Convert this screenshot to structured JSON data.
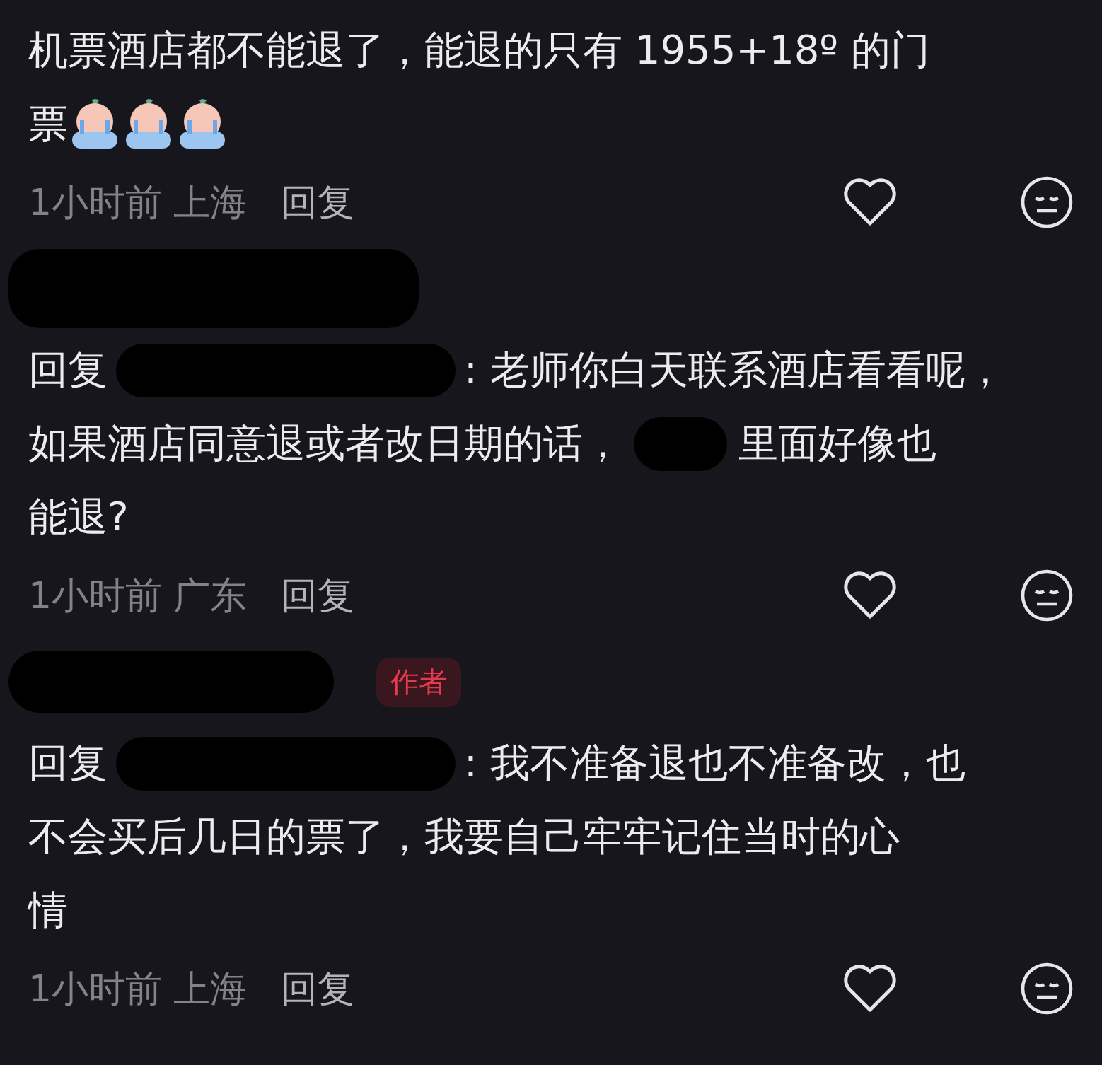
{
  "comments": [
    {
      "lines": [
        [
          {
            "kind": "text",
            "text": "机票酒店都不能退了，能退的只有 1955+18º 的门"
          }
        ],
        [
          {
            "kind": "text",
            "text": "票"
          },
          {
            "kind": "emoji"
          },
          {
            "kind": "emoji"
          },
          {
            "kind": "emoji"
          }
        ]
      ],
      "time": "1小时前",
      "location": "上海",
      "reply": "回复"
    },
    {
      "header": {
        "kind": "redacted_name"
      },
      "lines": [
        [
          {
            "kind": "text",
            "text": "回复"
          },
          {
            "kind": "redaction_long"
          },
          {
            "kind": "text",
            "text": ": 老师你白天联系酒店看看呢，"
          }
        ],
        [
          {
            "kind": "text",
            "text": "如果酒店同意退或者改日期的话，"
          },
          {
            "kind": "redaction_short"
          },
          {
            "kind": "text",
            "text": "里面好像也"
          }
        ],
        [
          {
            "kind": "text",
            "text": "能退?"
          }
        ]
      ],
      "time": "1小时前",
      "location": "广东",
      "reply": "回复"
    },
    {
      "header": {
        "kind": "redacted_name",
        "badge": "作者"
      },
      "lines": [
        [
          {
            "kind": "text",
            "text": "回复"
          },
          {
            "kind": "redaction_long"
          },
          {
            "kind": "text",
            "text": ": 我不准备退也不准备改，也"
          }
        ],
        [
          {
            "kind": "text",
            "text": "不会买后几日的票了，我要自己牢牢记住当时的心"
          }
        ],
        [
          {
            "kind": "text",
            "text": "情"
          }
        ]
      ],
      "time": "1小时前",
      "location": "上海",
      "reply": "回复"
    }
  ]
}
